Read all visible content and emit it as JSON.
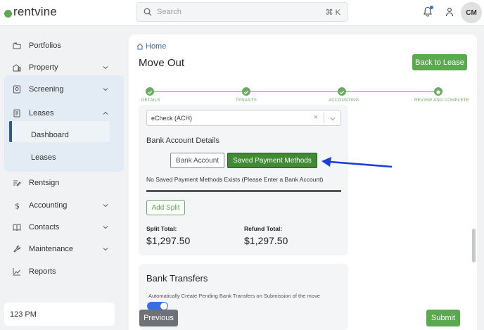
{
  "app": {
    "logo_text": "rentvine"
  },
  "search": {
    "placeholder": "Search",
    "shortcut": "⌘ K"
  },
  "header": {
    "avatar_initials": "CM"
  },
  "sidebar": {
    "items": [
      {
        "label": "Portfolios",
        "icon": "folder-icon"
      },
      {
        "label": "Property",
        "icon": "building-icon"
      },
      {
        "label": "Screening",
        "icon": "screening-icon"
      },
      {
        "label": "Leases",
        "icon": "document-icon"
      },
      {
        "label": "Rentsign",
        "icon": "signature-icon"
      },
      {
        "label": "Accounting",
        "icon": "dollar-icon"
      },
      {
        "label": "Contacts",
        "icon": "book-icon"
      },
      {
        "label": "Maintenance",
        "icon": "wrench-icon"
      },
      {
        "label": "Reports",
        "icon": "chart-icon"
      }
    ],
    "leases_sub": [
      "Dashboard",
      "Leases"
    ],
    "status_time": "123 PM"
  },
  "main": {
    "breadcrumb": "Home",
    "title": "Move Out",
    "back_button": "Back to Lease",
    "steps": [
      "DETAILS",
      "TENANTS",
      "ACCOUNTING",
      "REVIEW AND COMPLETE"
    ],
    "payment_method": "eCheck (ACH)",
    "bank_details_label": "Bank Account Details",
    "bank_account_button": "Bank Account",
    "saved_methods_button": "Saved Payment Methods",
    "notice": "No Saved Payment Methods Exists (Please Enter a Bank Account)",
    "add_split": "Add Split",
    "split_total_label": "Split Total:",
    "split_total_value": "$1,297.50",
    "refund_total_label": "Refund Total:",
    "refund_total_value": "$1,297.50",
    "bank_transfers_title": "Bank Transfers",
    "bank_transfers_text": "Automatically Create Pending Bank Transfers on Submission of the move",
    "previous_button": "Previous",
    "submit_button": "Submit"
  },
  "colors": {
    "accent": "#5aa84f",
    "primary_dark": "#3f8a32",
    "arrow": "#1a3fd6"
  }
}
